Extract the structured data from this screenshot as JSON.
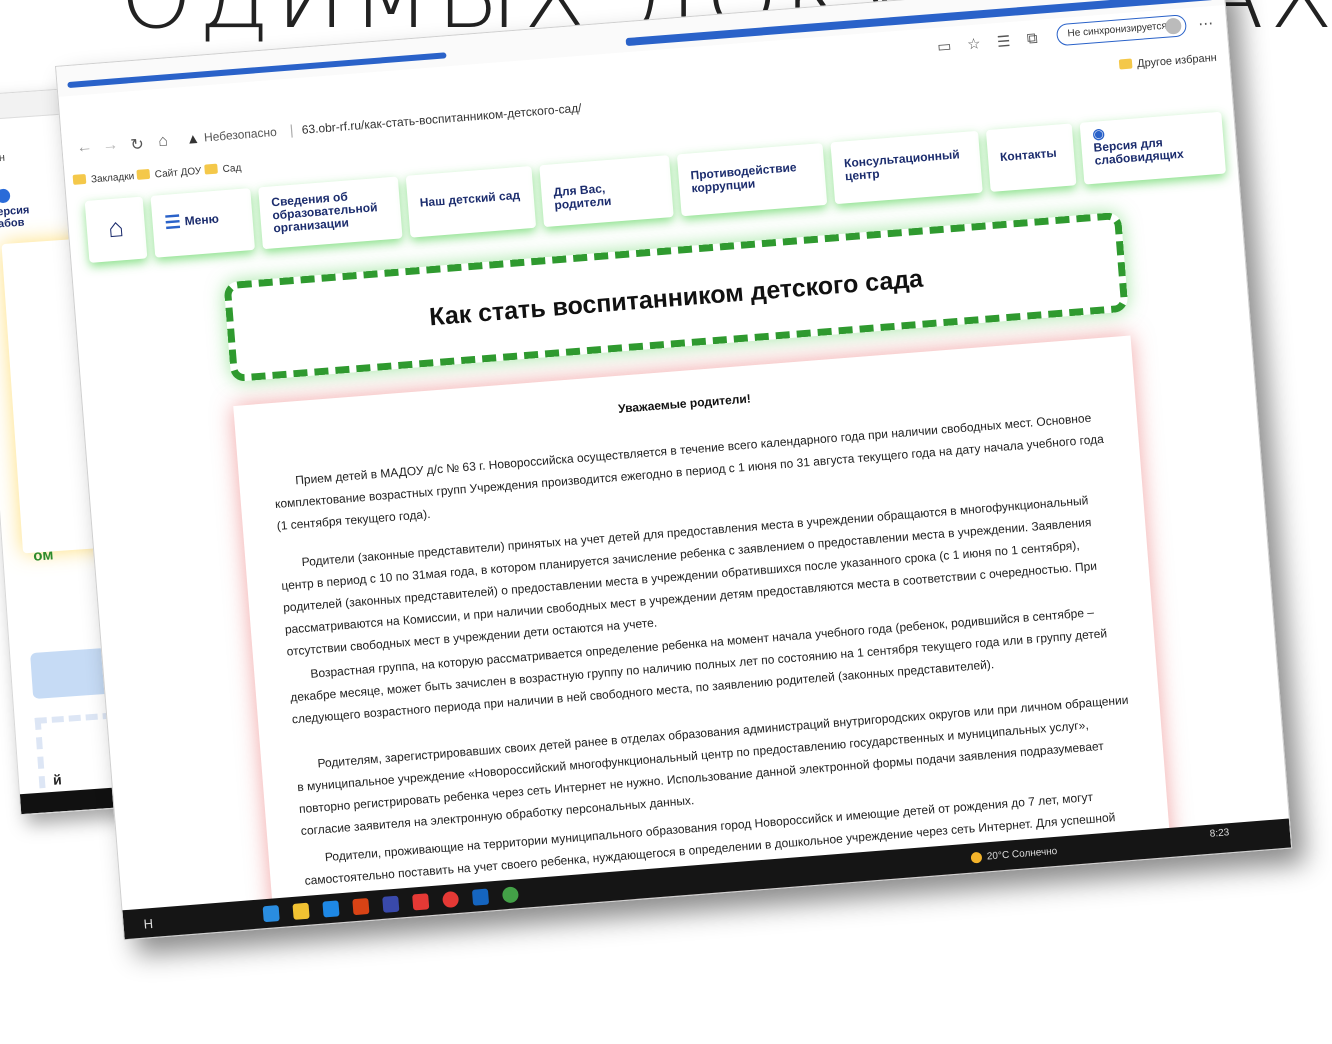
{
  "slide": {
    "title": "ОДИМЫХ ДОКУМЕНТАХ"
  },
  "back_screenshot": {
    "tab_fragment": "сн",
    "version_fragment": "ерсия\nабов",
    "text_fragment": "ом",
    "text_fragment2": "й"
  },
  "browser": {
    "security_label": "Небезопасно",
    "url": "63.obr-rf.ru/как-стать-воспитанником-детского-сад/",
    "sync_label": "Не синхронизируется",
    "other_bookmarks": "Другое избранн",
    "bookmarks": [
      "Закладки",
      "Сайт ДОУ",
      "Сад"
    ],
    "icons": [
      "back-icon",
      "forward-icon",
      "reload-icon",
      "home-icon",
      "warning-icon",
      "reader-icon",
      "favorite-icon",
      "collections-icon",
      "sync-icon"
    ]
  },
  "site_nav": {
    "menu_label": "Меню",
    "items": [
      "Сведения об образовательной организации",
      "Наш детский сад",
      "Для Вас, родители",
      "Противодействие коррупции",
      "Консультационный центр",
      "Контакты",
      "Версия для слабовидящих"
    ]
  },
  "page": {
    "title": "Как стать воспитанником детского сада",
    "greeting": "Уважаемые родители!",
    "paragraphs": [
      "Прием детей в МАДОУ д/с № 63 г. Новороссийска осуществляется в течение всего календарного года при наличии свободных мест. Основное комплектование возрастных групп Учреждения производится ежегодно в период с 1 июня по 31 августа текущего года на дату начала учебного года (1 сентября текущего года).",
      "Родители (законные представители) принятых на учет детей для предоставления места в учреждении обращаются в многофункциональный центр в период с 10 по 31мая года, в котором планируется зачисление ребенка с заявлением о предоставлении места в учреждении. Заявления родителей (законных представителей) о предоставлении места в учреждении обратившихся после указанного срока (с 1 июня по 1 сентября), рассматриваются на Комиссии, и при наличии свободных мест в учреждении детям предоставляются места в соответствии с очередностью. При отсутствии свободных мест в учреждении дети остаются на учете.",
      "Возрастная группа, на которую рассматривается определение ребенка на момент начала учебного года (ребенок, родившийся в сентябре – декабре месяце, может быть зачислен в возрастную группу по наличию полных лет по состоянию на 1 сентября текущего года или в группу детей следующего возрастного периода при наличии в ней свободного места, по заявлению родителей (законных представителей).",
      "Родителям, зарегистрировавших своих детей ранее в отделах образования администраций внутригородских округов или при личном обращении в муниципальное учреждение «Новороссийский многофункциональный центр по предоставлению государственных и муниципальных услуг», повторно регистрировать ребенка через сеть Интернет не нужно. Использование данной электронной формы подачи заявления подразумевает согласие заявителя на электронную обработку персональных данных.",
      "Родители, проживающие на территории муниципального образования город Новороссийск и имеющие детей от рождения до 7 лет, могут самостоятельно поставить на учет своего ребенка, нуждающегося в определении в дошкольное учреждение через сеть Интернет. Для успешной постановки на учет Вашего ребёнка необходимо"
    ]
  },
  "taskbar": {
    "search_glyph": "Н",
    "weather": "20°C Солнечно",
    "time": "8:23"
  },
  "colors": {
    "accent_blue": "#2a62c9",
    "nav_glow_green": "#78dc78",
    "title_border_green": "#2f9a2f",
    "content_glow_red": "#e65a5a",
    "nav_text": "#1c2d6e"
  }
}
